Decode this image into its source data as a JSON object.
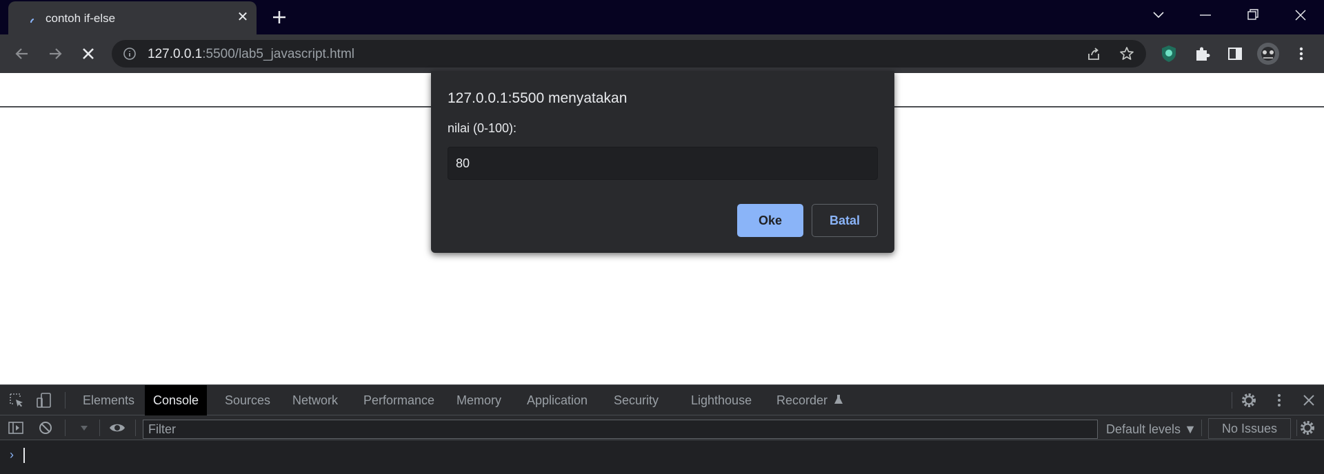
{
  "tab": {
    "title": "contoh if-else",
    "close_glyph": "✕",
    "icon": "loading-spinner-icon"
  },
  "toolbar": {
    "url_host": "127.0.0.1",
    "url_path": ":5500/lab5_javascript.html"
  },
  "dialog": {
    "origin": "127.0.0.1:5500 menyatakan",
    "message": "nilai (0-100):",
    "input_value": "80",
    "ok_label": "Oke",
    "cancel_label": "Batal"
  },
  "devtools": {
    "tabs": [
      "Elements",
      "Console",
      "Sources",
      "Network",
      "Performance",
      "Memory",
      "Application",
      "Security",
      "Lighthouse",
      "Recorder"
    ],
    "active_tab": "Console",
    "filter_placeholder": "Filter",
    "levels_label": "Default levels",
    "issues_label": "No Issues",
    "prompt_glyph": "›"
  },
  "colors": {
    "accent": "#8ab4f8",
    "tabstrip": "#060321",
    "toolbar": "#35363a",
    "dialog": "#292a2d"
  }
}
